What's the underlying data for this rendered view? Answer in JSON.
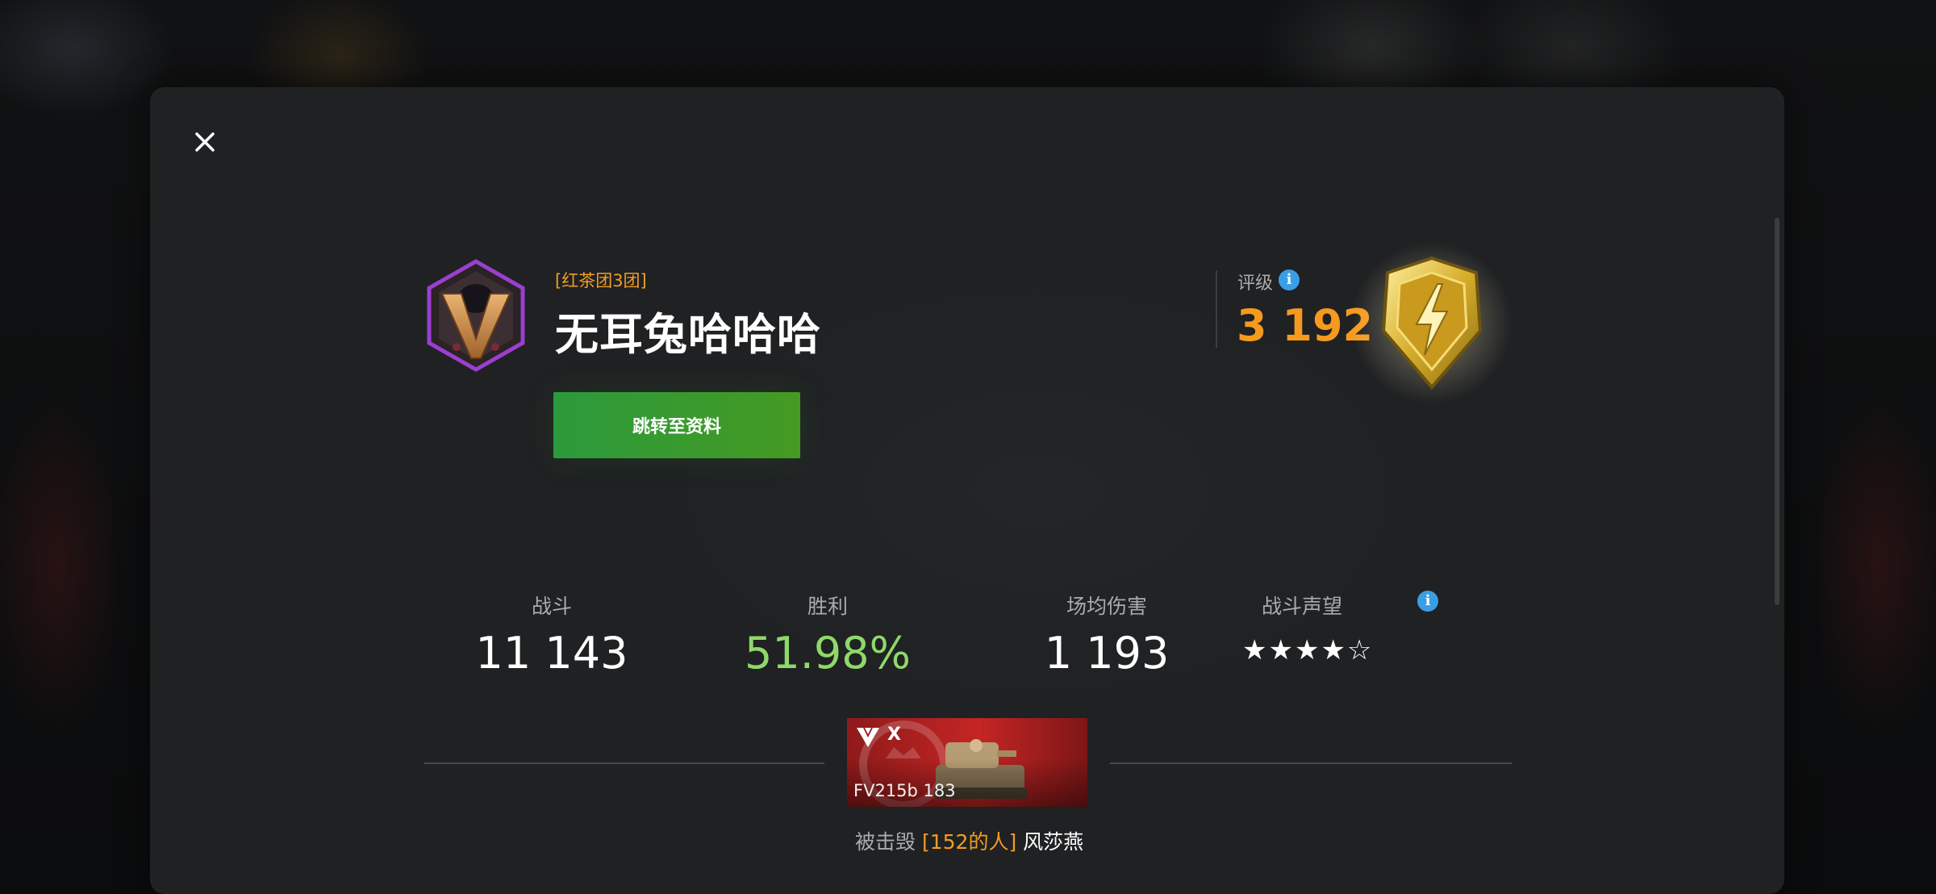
{
  "player": {
    "clan_tag": "[红茶团3团]",
    "name": "无耳兔哈哈哈",
    "profile_button": "跳转至资料"
  },
  "rating": {
    "label": "评级",
    "value": "3 192",
    "info_icon": "i"
  },
  "stats": [
    {
      "label": "战斗",
      "value": "11 143"
    },
    {
      "label": "胜利",
      "value": "51.98%"
    },
    {
      "label": "场均伤害",
      "value": "1 193"
    },
    {
      "label": "战斗声望",
      "value": "★★★★☆",
      "stars_filled": 4,
      "stars_total": 5
    }
  ],
  "kill_card": {
    "tier": "X",
    "tank_name": "FV215b 183",
    "destroyed_prefix": "被击毁",
    "destroyed_clan": "[152的人]",
    "destroyed_player": "风莎燕"
  },
  "colors": {
    "accent_orange": "#f39c22",
    "win_green": "#8fd86a",
    "button_green": "#2b9a3c",
    "info_blue": "#3a9ee6",
    "panel_bg": "#1f2123"
  },
  "icons": [
    "close-icon",
    "clan-emblem-icon",
    "info-icon",
    "rating-league-badge-icon",
    "tank-class-icon"
  ]
}
